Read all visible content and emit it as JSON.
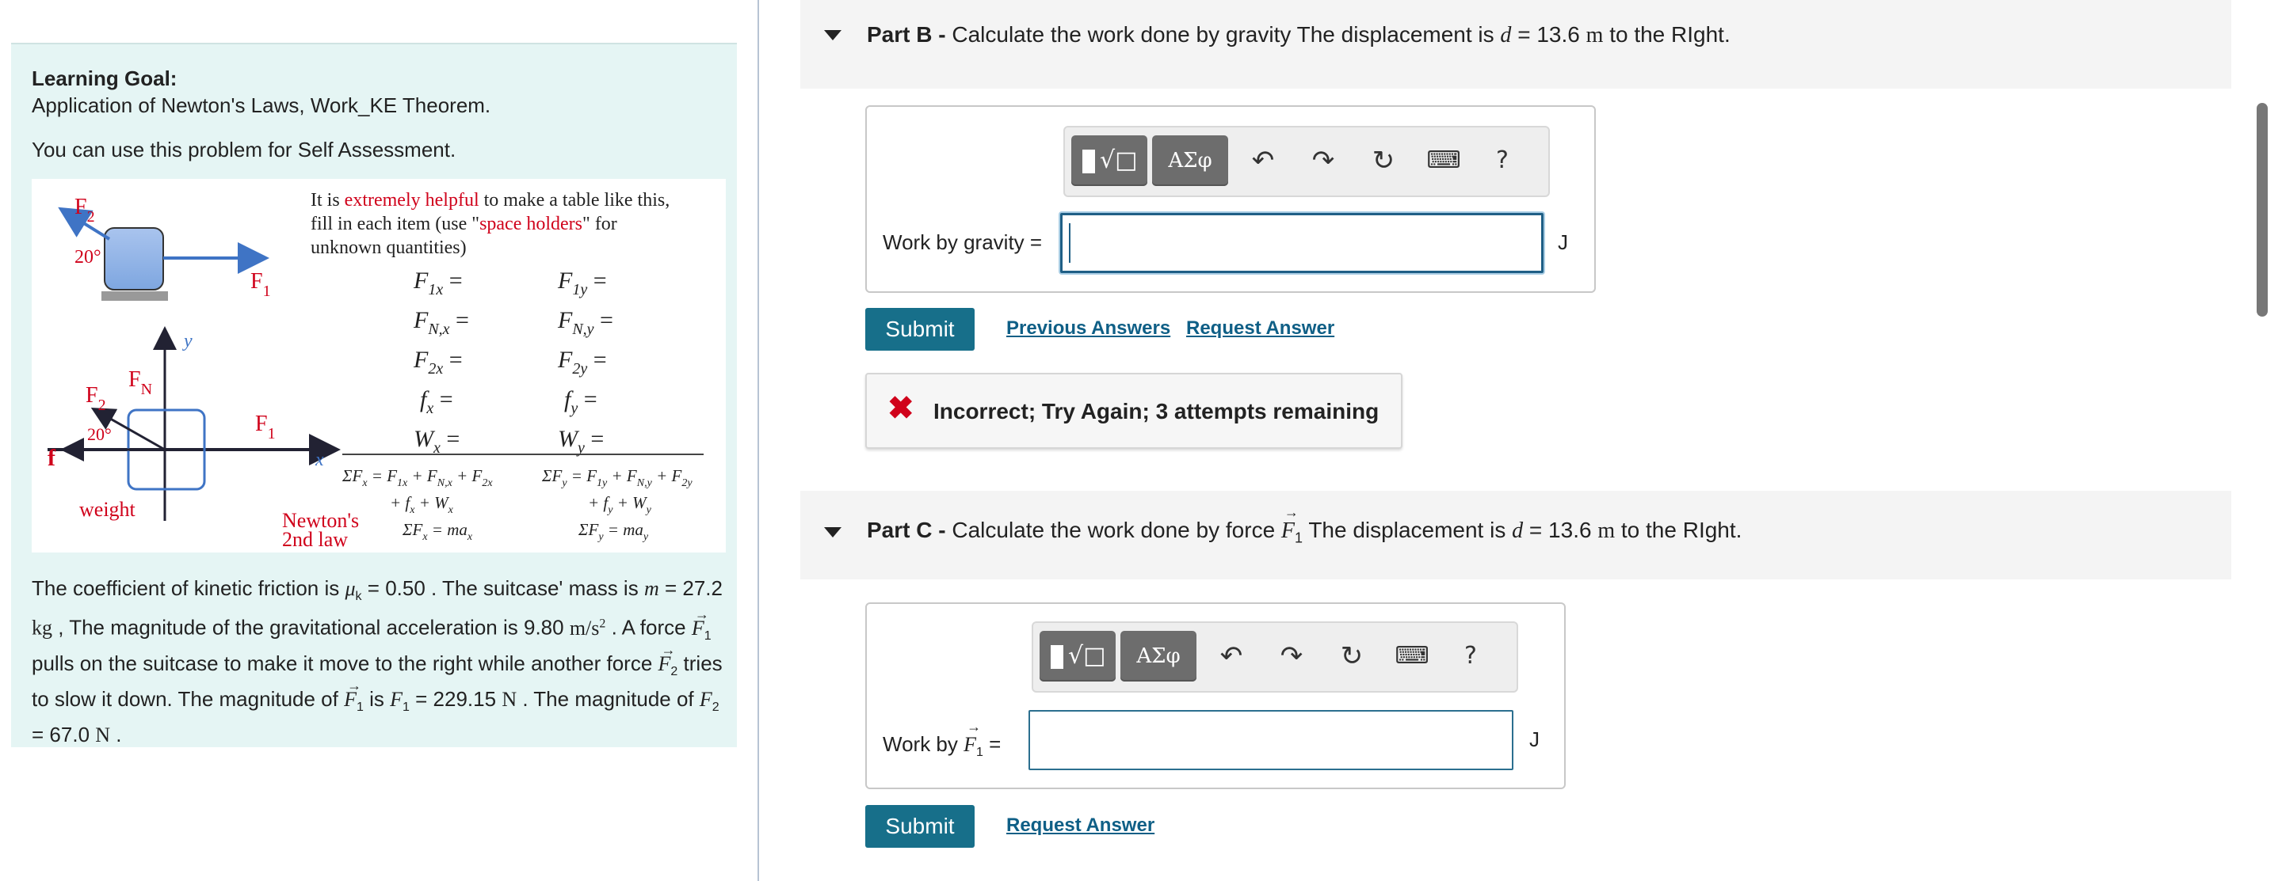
{
  "learning_goal": {
    "title": "Learning Goal:",
    "subtitle": "Application of Newton's Laws, Work_KE Theorem.",
    "self_assessment": "You can use this problem for Self Assessment."
  },
  "figure": {
    "note_prefix": "It is ",
    "note_highlight": "extremely helpful",
    "note_mid": " to make a table like this,",
    "note_line2a": "fill in each item (use \"",
    "note_line2_highlight": "space holders",
    "note_line2b": "\" for",
    "note_line3": "unknown quantities)",
    "label_F2": "F",
    "label_F2_sub": "2",
    "label_F1": "F",
    "label_F1_sub": "1",
    "label_FN": "F",
    "label_FN_sub": "N",
    "label_angle": "20°",
    "label_f": "f",
    "label_weight": "weight",
    "label_x": "x",
    "label_y": "y",
    "newtons_line1": "Newton's",
    "newtons_line2": "2nd law",
    "colors": {
      "red": "#d0021b",
      "blue": "#3f74c5"
    }
  },
  "problem": {
    "mu_k": "0.50",
    "mass": "27.2",
    "mass_unit": "kg",
    "g": "9.80",
    "F1": "229.15",
    "F2": "67.0",
    "force_unit": "N"
  },
  "partB": {
    "label": "Part B -",
    "question": "Calculate the work done by gravity The displacement is",
    "d_var": "d",
    "d_value": "13.6",
    "d_unit": "m",
    "d_tail": "to the RIght.",
    "field_label": "Work by gravity =",
    "unit": "J",
    "submit": "Submit",
    "previous_answers": "Previous Answers",
    "request_answer": "Request Answer",
    "feedback": "Incorrect; Try Again; 3 attempts remaining"
  },
  "partC": {
    "label": "Part C -",
    "question": "Calculate the work done by force",
    "force_var": "F",
    "force_sub": "1",
    "question_tail": "The displacement is",
    "d_var": "d",
    "d_value": "13.6",
    "d_unit": "m",
    "d_tail": "to the RIght.",
    "field_label_prefix": "Work by",
    "unit": "J",
    "submit": "Submit",
    "request_answer": "Request Answer"
  },
  "toolbar": {
    "greek_label": "ΑΣφ",
    "help_label": "?",
    "icons": [
      "templates-icon",
      "greek-symbols-icon",
      "undo-icon",
      "redo-icon",
      "reset-icon",
      "keyboard-icon",
      "help-icon"
    ]
  }
}
